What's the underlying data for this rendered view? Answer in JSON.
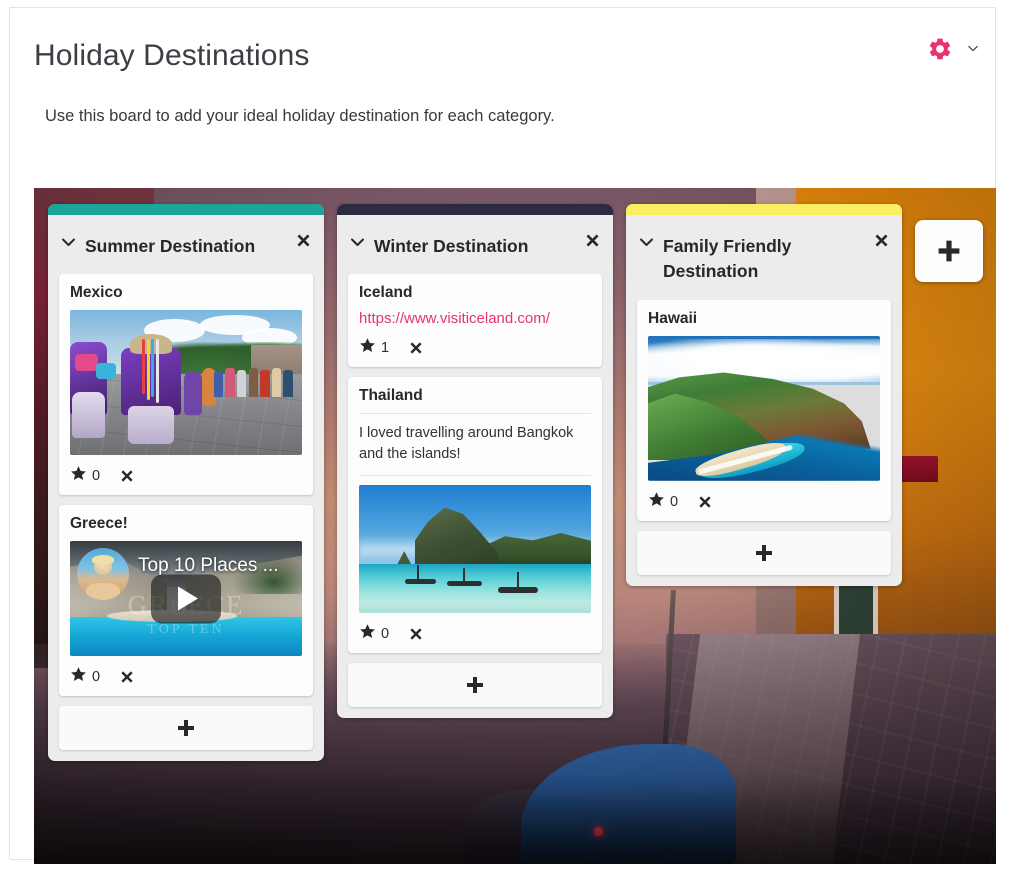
{
  "header": {
    "title": "Holiday Destinations",
    "subtitle": "Use this board to add your ideal holiday destination for each category.",
    "settings_icon": "gear-icon",
    "settings_caret_icon": "chevron-down-icon",
    "accent_color": "#e8336d"
  },
  "board": {
    "add_column_label": "+",
    "add_card_label": "+",
    "close_label": "✖",
    "collapse_icon": "chevron-down-icon",
    "star_icon": "star-icon",
    "delete_icon": "close-icon",
    "columns": [
      {
        "title": "Summer Destination",
        "stripe_color": "#1aa79a",
        "add_card_label": "+",
        "cards": [
          {
            "title": "Mexico",
            "media_type": "image",
            "media_alt": "Mexican street festival parade with colourful costumes",
            "stars": "0"
          },
          {
            "title": "Greece!",
            "media_type": "video",
            "video_title": "Top 10 Places ...",
            "video_watermark": "GREECE",
            "video_watermark_sub": "TOP TEN",
            "media_alt": "Navagio beach Zakynthos cliffs and turquoise bay",
            "stars": "0"
          }
        ]
      },
      {
        "title": "Winter Destination",
        "stripe_color": "#2b2c44",
        "add_card_label": "+",
        "cards": [
          {
            "title": "Iceland",
            "media_type": "link",
            "link_text": "https://www.visiticeland.com/",
            "stars": "1"
          },
          {
            "title": "Thailand",
            "media_type": "image",
            "description": "I loved travelling around Bangkok and the islands!",
            "media_alt": "Phi Phi island limestone cliff with longtail boats",
            "stars": "0"
          }
        ]
      },
      {
        "title": "Family Friendly Destination",
        "stripe_color": "#fbee62",
        "add_card_label": "+",
        "cards": [
          {
            "title": "Hawaii",
            "media_type": "image",
            "media_alt": "Napali coast Kauai green cliffs and turquoise ocean",
            "stars": "0"
          }
        ]
      }
    ]
  }
}
